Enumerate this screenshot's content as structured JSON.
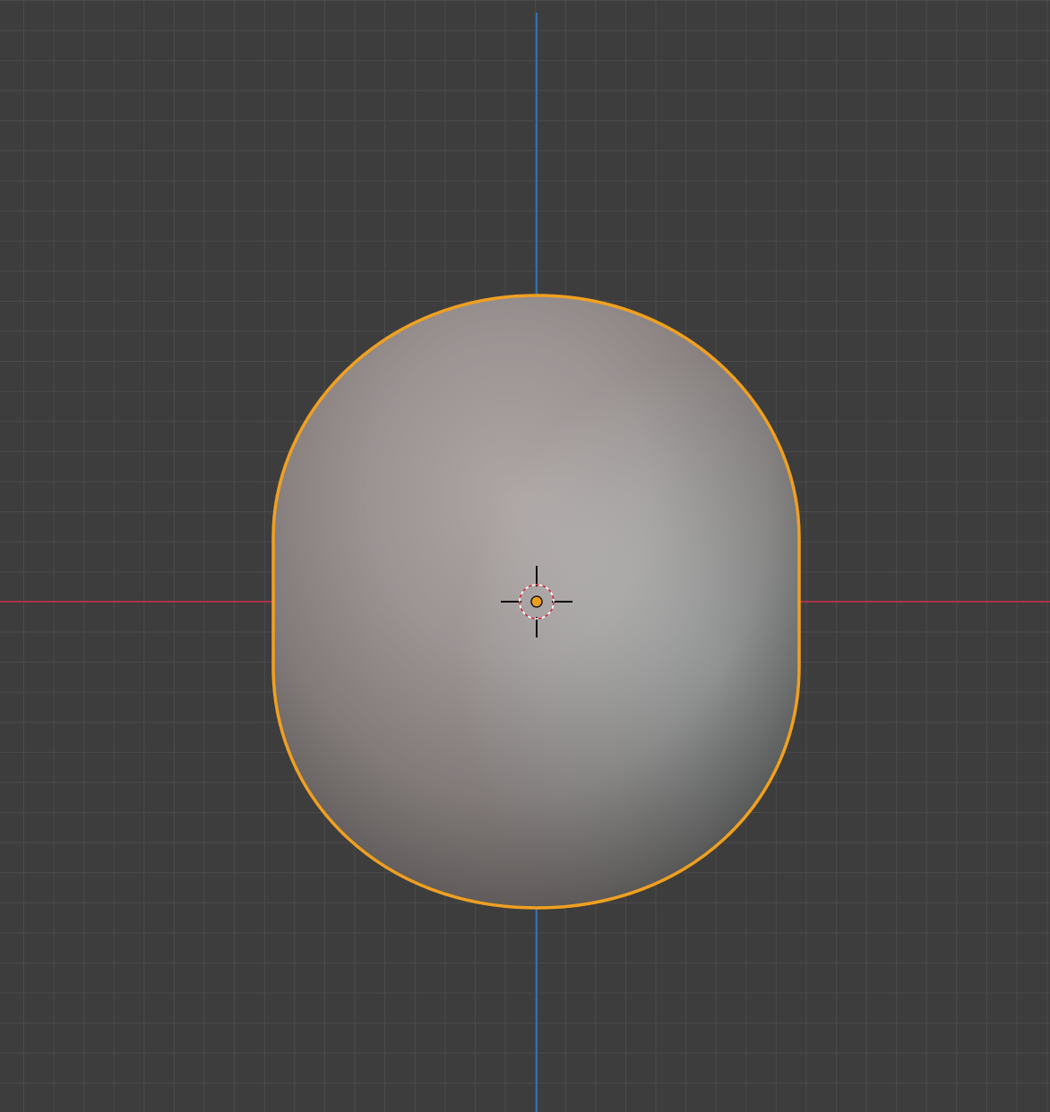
{
  "viewport": {
    "mode": "3d-viewport-front-orthographic",
    "grid": true,
    "colors": {
      "background": "#3d3d3d",
      "grid_line": "#4b4b4b",
      "axis_x": "#a93447",
      "axis_z": "#2f6fb0",
      "selection_outline": "#f0a020",
      "origin_dot": "#f0a020"
    }
  },
  "scene": {
    "object": {
      "shape": "capsule-sphere",
      "selected": true,
      "shading": "solid"
    },
    "origin": {
      "visible": true
    },
    "cursor_3d": {
      "visible": true,
      "icon": "crosshair-icon"
    }
  }
}
